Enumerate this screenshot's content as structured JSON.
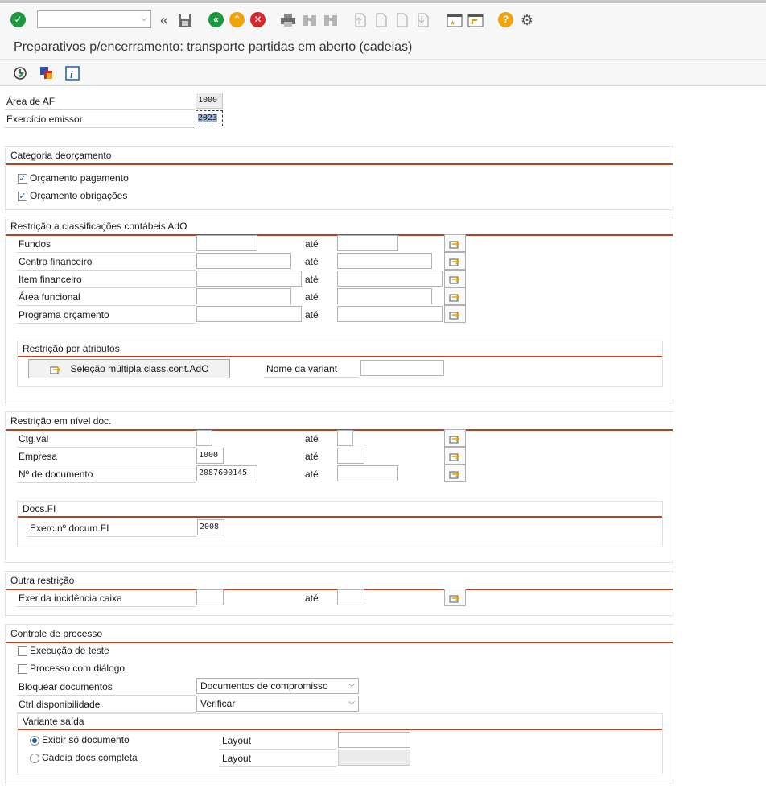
{
  "header": {
    "title": "Preparativos p/encerramento: transporte partidas em aberto (cadeias)"
  },
  "toolbar": {
    "icons": [
      "check-icon",
      "back-double-icon",
      "save-icon",
      "back-icon",
      "exit-icon",
      "cancel-icon",
      "print-icon",
      "find-icon",
      "find-next-icon",
      "first-page-icon",
      "prev-page-icon",
      "next-page-icon",
      "last-page-icon",
      "new-session-icon",
      "shortcut-icon",
      "help-icon",
      "settings-icon"
    ]
  },
  "fields": {
    "area_af": {
      "label": "Área de AF",
      "value": "1000"
    },
    "exercicio": {
      "label": "Exercício emissor",
      "value": "2023"
    }
  },
  "categoria": {
    "title": "Categoria deorçamento",
    "pagamento": "Orçamento pagamento",
    "obrigacoes": "Orçamento obrigações"
  },
  "restricao": {
    "title": "Restrição a classificações contábeis AdO",
    "ate": "até",
    "rows": [
      {
        "label": "Fundos"
      },
      {
        "label": "Centro financeiro"
      },
      {
        "label": "Item financeiro"
      },
      {
        "label": "Área funcional"
      },
      {
        "label": "Programa orçamento"
      }
    ],
    "atributos": {
      "title": "Restrição por atributos",
      "button": "Seleção múltipla class.cont.AdO",
      "variant_label": "Nome da variant"
    }
  },
  "doc": {
    "title": "Restrição em nível doc.",
    "rows": [
      {
        "label": "Ctg.val",
        "value": ""
      },
      {
        "label": "Empresa",
        "value": "1000"
      },
      {
        "label": "Nº de documento",
        "value": "2087600145"
      }
    ],
    "docsfi": {
      "title": "Docs.FI",
      "label": "Exerc.nº docum.FI",
      "value": "2008"
    }
  },
  "outra": {
    "title": "Outra restrição",
    "label": "Exer.da incidência caixa"
  },
  "controle": {
    "title": "Controle de processo",
    "teste": "Execução de teste",
    "dialogo": "Processo com diálogo",
    "bloquear_label": "Bloquear documentos",
    "bloquear_value": "Documentos de compromisso",
    "ctrl_label": "Ctrl.disponibilidade",
    "ctrl_value": "Verificar",
    "variante": {
      "title": "Variante saída",
      "exibir": "Exibir só documento",
      "cadeia": "Cadeia docs.completa",
      "layout": "Layout"
    }
  },
  "colors": {
    "accent": "#b8401a",
    "ok_green": "#1a9a3c",
    "cancel_red": "#d6262b",
    "help_orange": "#f0a30a"
  }
}
